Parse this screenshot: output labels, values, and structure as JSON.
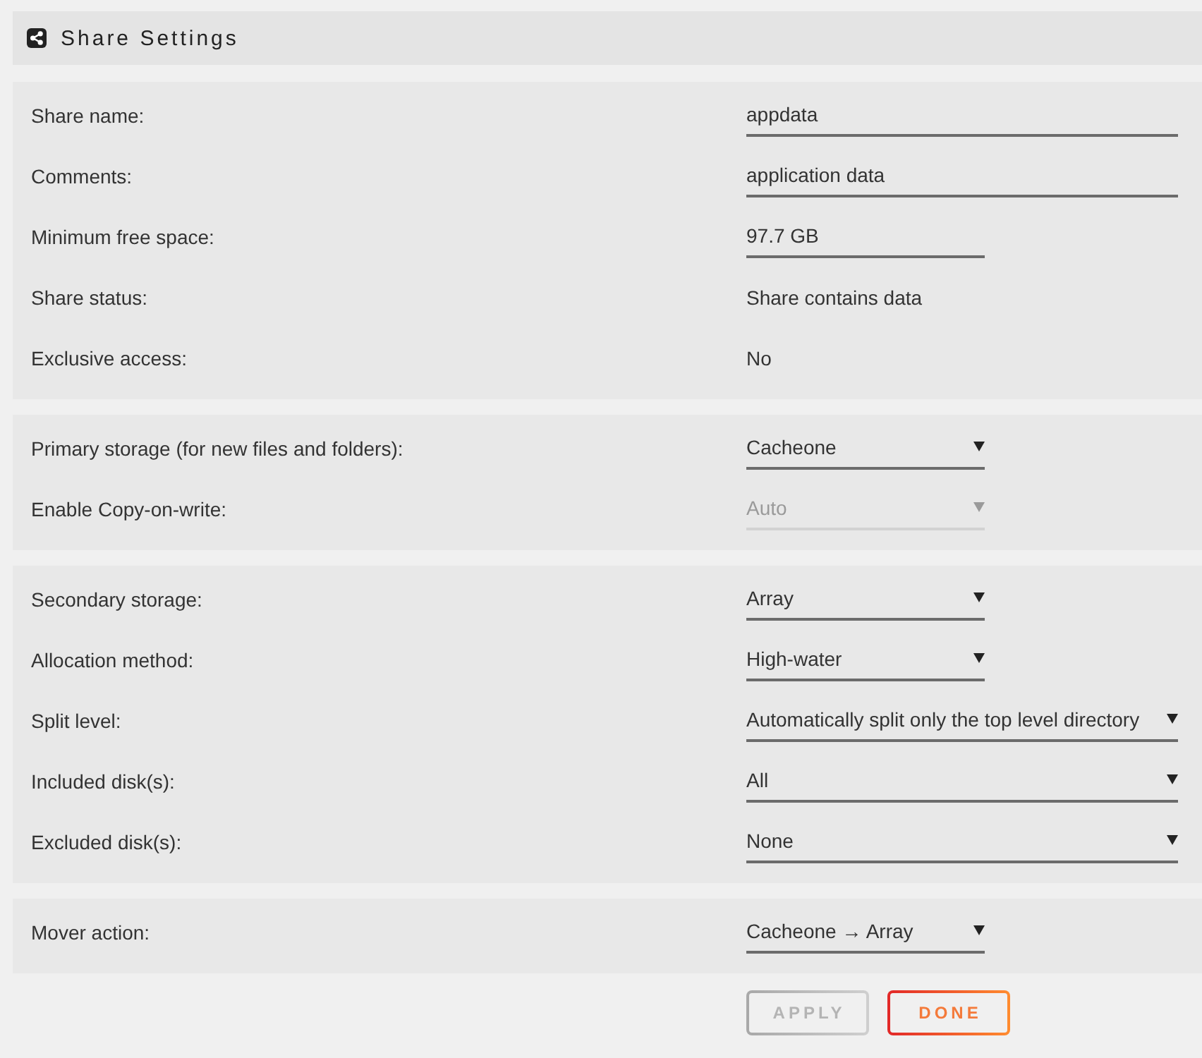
{
  "header": {
    "title": "Share Settings"
  },
  "sections": [
    {
      "rows": [
        {
          "label": "Share name:",
          "kind": "input",
          "value": "appdata",
          "disabled": false
        },
        {
          "label": "Comments:",
          "kind": "input",
          "value": "application data",
          "disabled": false
        },
        {
          "label": "Minimum free space:",
          "kind": "short-input",
          "value": "97.7 GB",
          "disabled": false
        },
        {
          "label": "Share status:",
          "kind": "text",
          "value": "Share contains data",
          "disabled": false
        },
        {
          "label": "Exclusive access:",
          "kind": "text",
          "value": "No",
          "disabled": false
        }
      ]
    },
    {
      "rows": [
        {
          "label": "Primary storage (for new files and folders):",
          "kind": "select",
          "value": "Cacheone",
          "disabled": false
        },
        {
          "label": "Enable Copy-on-write:",
          "kind": "select",
          "value": "Auto",
          "disabled": true
        }
      ]
    },
    {
      "rows": [
        {
          "label": "Secondary storage:",
          "kind": "select",
          "value": "Array",
          "disabled": false
        },
        {
          "label": "Allocation method:",
          "kind": "select",
          "value": "High-water",
          "disabled": false
        },
        {
          "label": "Split level:",
          "kind": "wide-select",
          "value": "Automatically split only the top level directory",
          "disabled": false
        },
        {
          "label": "Included disk(s):",
          "kind": "wide-select",
          "value": "All",
          "disabled": false
        },
        {
          "label": "Excluded disk(s):",
          "kind": "wide-select",
          "value": "None",
          "disabled": false
        }
      ]
    },
    {
      "rows": [
        {
          "label": "Mover action:",
          "kind": "select",
          "value": "Cacheone → Array",
          "disabled": false
        }
      ]
    }
  ],
  "buttons": [
    {
      "label": "APPLY",
      "disabled": true
    },
    {
      "label": "DONE",
      "disabled": false
    }
  ]
}
